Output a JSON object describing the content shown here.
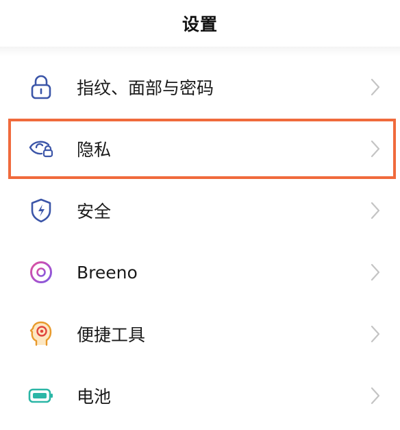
{
  "header": {
    "title": "设置"
  },
  "settings": {
    "items": [
      {
        "label": "指纹、面部与密码",
        "icon": "lock-icon"
      },
      {
        "label": "隐私",
        "icon": "eye-lock-icon"
      },
      {
        "label": "安全",
        "icon": "shield-bolt-icon"
      },
      {
        "label": "Breeno",
        "icon": "breeno-ring-icon"
      },
      {
        "label": "便捷工具",
        "icon": "head-target-icon"
      },
      {
        "label": "电池",
        "icon": "battery-icon"
      }
    ]
  },
  "colors": {
    "highlight": "#f06a3c",
    "icon_blue": "#3b55a8",
    "battery_teal": "#2bb6a6",
    "chevron": "#c4c4c4"
  }
}
